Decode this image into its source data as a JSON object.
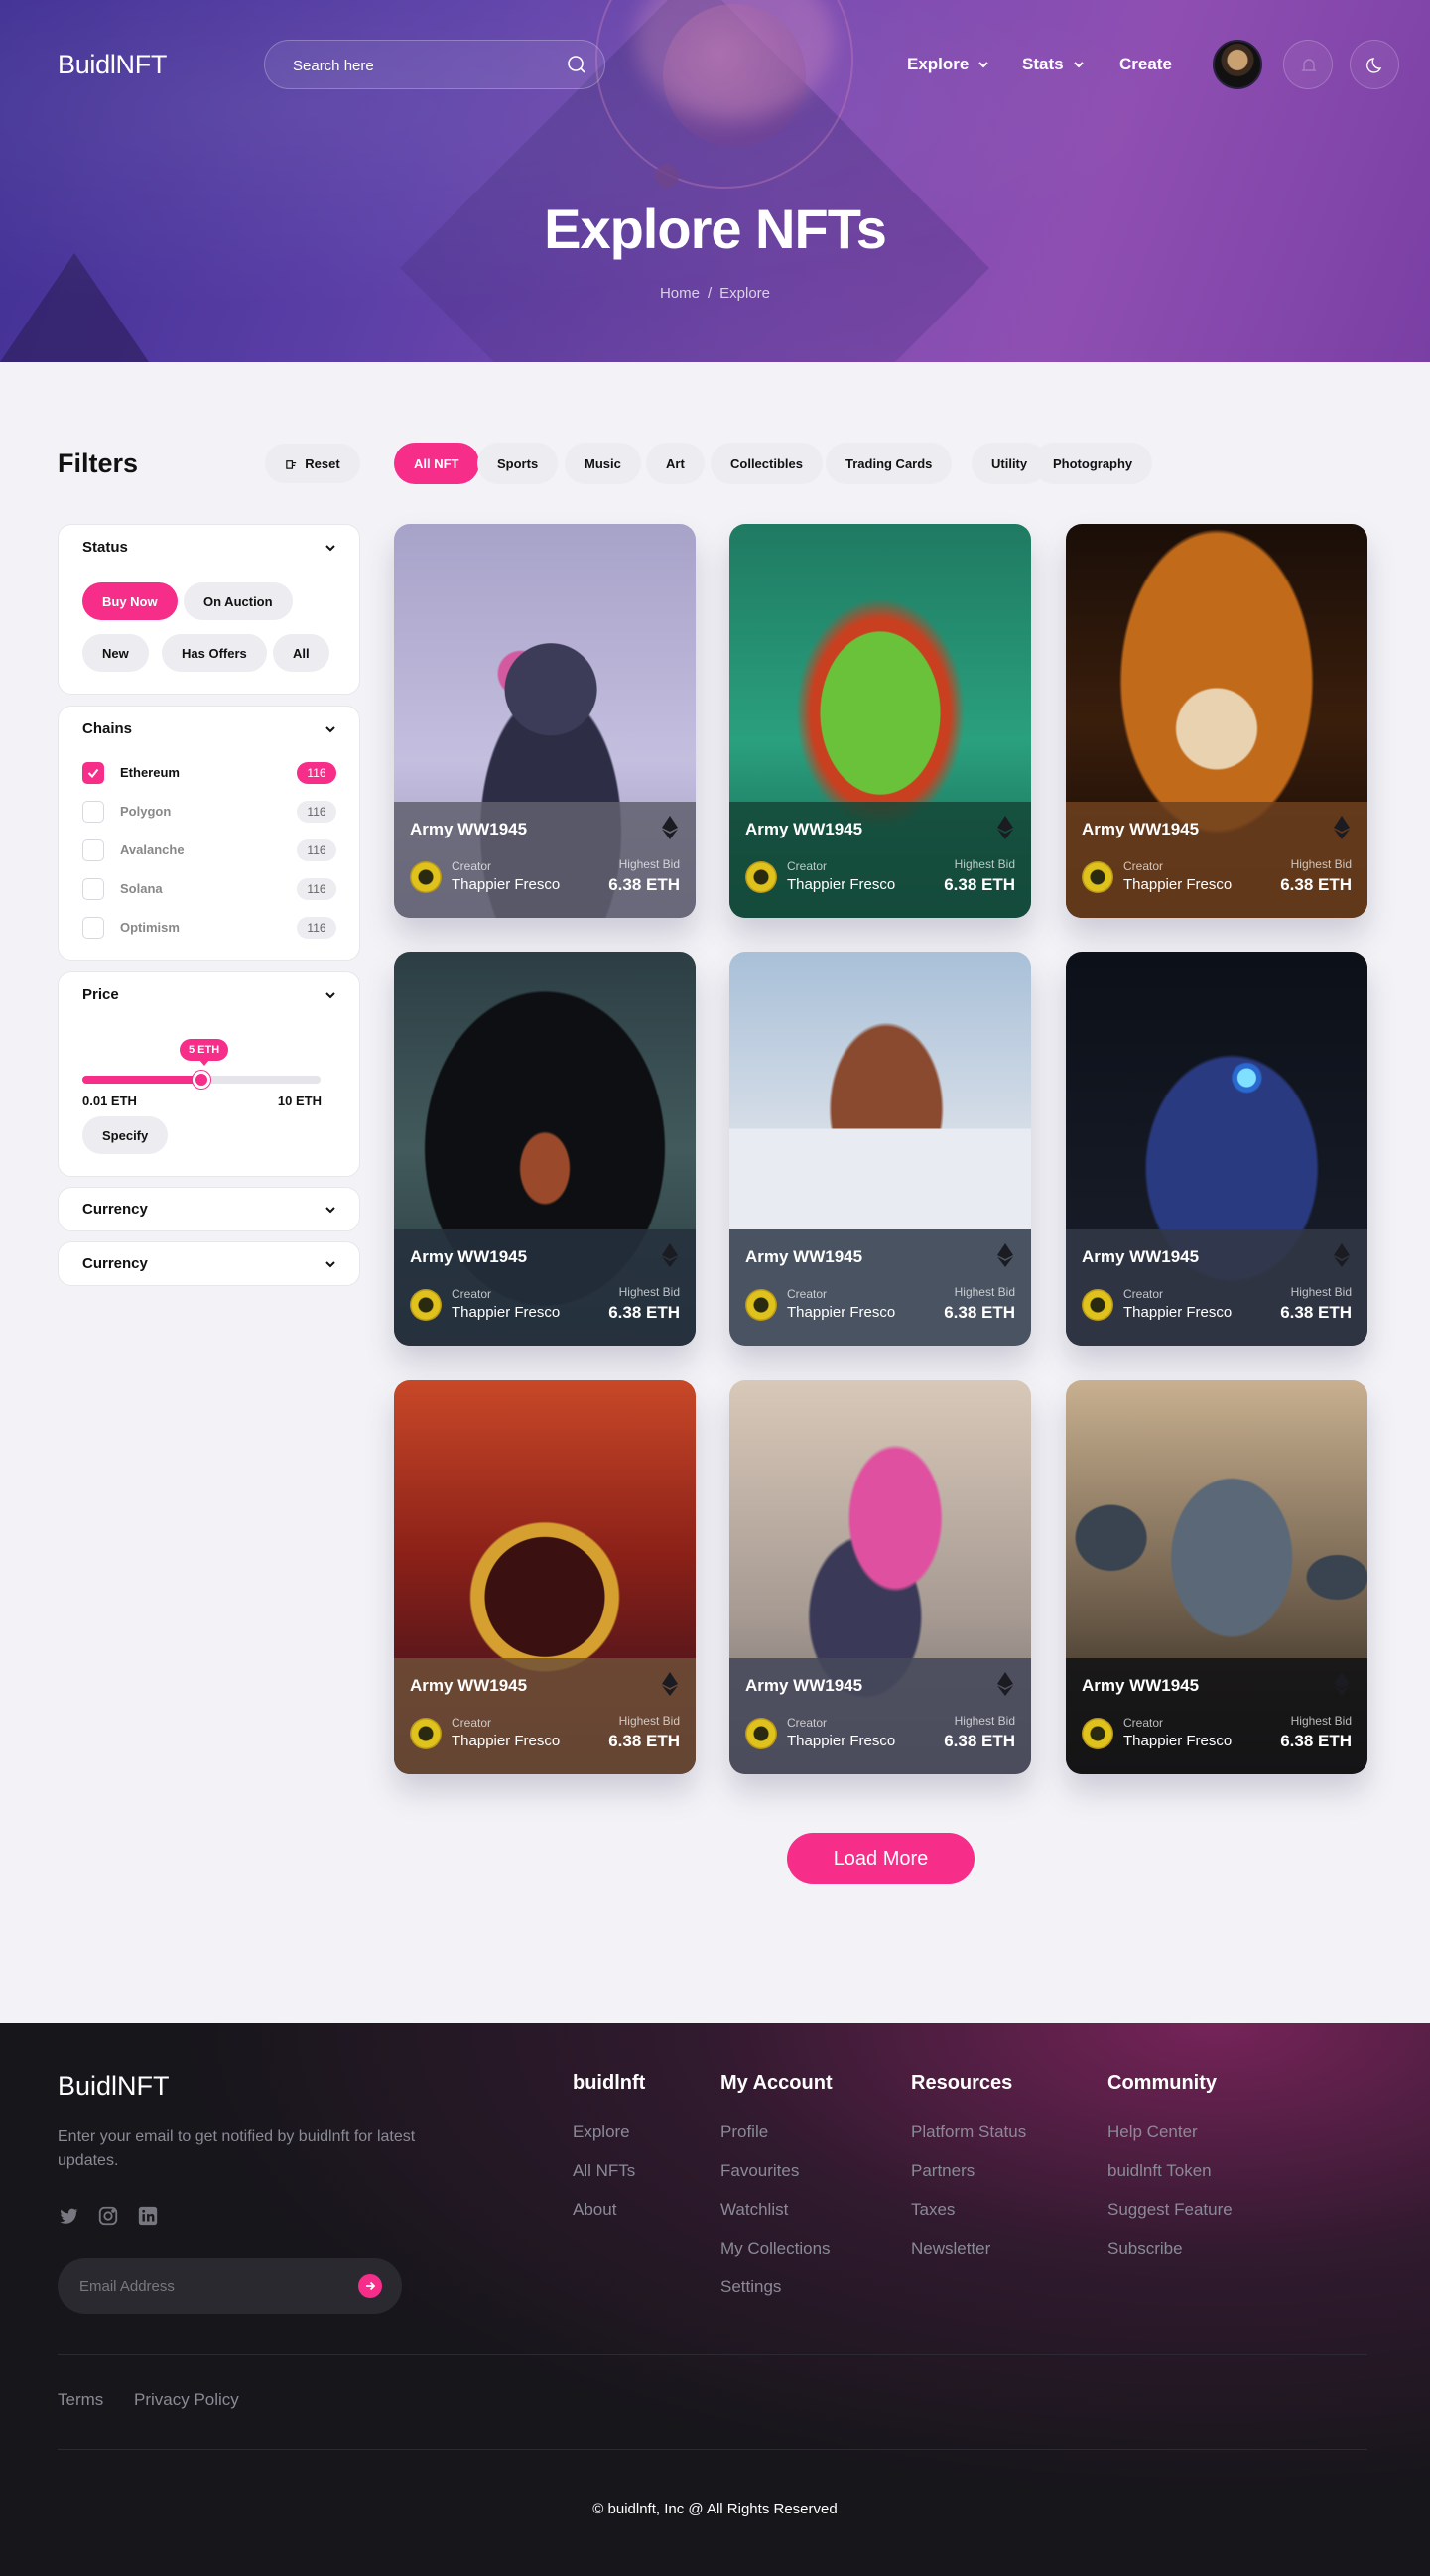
{
  "header": {
    "logo": "BuidlNFT",
    "search_placeholder": "Search here",
    "nav": [
      {
        "label": "Explore",
        "has_dropdown": true
      },
      {
        "label": "Stats",
        "has_dropdown": true
      },
      {
        "label": "Create",
        "has_dropdown": false
      }
    ]
  },
  "hero": {
    "title": "Explore NFTs",
    "breadcrumb": [
      "Home",
      "Explore"
    ],
    "breadcrumb_separator": "/"
  },
  "filters": {
    "title": "Filters",
    "reset_label": "Reset",
    "status": {
      "heading": "Status",
      "options": [
        "Buy Now",
        "On Auction",
        "New",
        "Has Offers",
        "All"
      ],
      "active": "Buy Now"
    },
    "chains": {
      "heading": "Chains",
      "items": [
        {
          "name": "Ethereum",
          "count": "116",
          "checked": true
        },
        {
          "name": "Polygon",
          "count": "116",
          "checked": false
        },
        {
          "name": "Avalanche",
          "count": "116",
          "checked": false
        },
        {
          "name": "Solana",
          "count": "116",
          "checked": false
        },
        {
          "name": "Optimism",
          "count": "116",
          "checked": false
        }
      ]
    },
    "price": {
      "heading": "Price",
      "current_label": "5 ETH",
      "current_value": 5,
      "min": 0.01,
      "max": 10,
      "min_label": "0.01 ETH",
      "max_label": "10 ETH",
      "specify_label": "Specify"
    },
    "currency_sections": [
      "Currency",
      "Currency"
    ]
  },
  "categories": {
    "items": [
      "All NFT",
      "Sports",
      "Music",
      "Art",
      "Collectibles",
      "Trading Cards",
      "Utility",
      "Photography"
    ],
    "active": "All NFT"
  },
  "cards": [
    {
      "name": "Army WW1945",
      "creator_label": "Creator",
      "creator": "Thappier Fresco",
      "bid_label": "Highest Bid",
      "bid": "6.38 ETH",
      "art": "floral-cyborg-head"
    },
    {
      "name": "Army WW1945",
      "creator_label": "Creator",
      "creator": "Thappier Fresco",
      "bid_label": "Highest Bid",
      "bid": "6.38 ETH",
      "art": "green-coral-sculpture"
    },
    {
      "name": "Army WW1945",
      "creator_label": "Creator",
      "creator": "Thappier Fresco",
      "bid_label": "Highest Bid",
      "bid": "6.38 ETH",
      "art": "golden-skull-horns"
    },
    {
      "name": "Army WW1945",
      "creator_label": "Creator",
      "creator": "Thappier Fresco",
      "bid_label": "Highest Bid",
      "bid": "6.38 ETH",
      "art": "winged-warrior"
    },
    {
      "name": "Army WW1945",
      "creator_label": "Creator",
      "creator": "Thappier Fresco",
      "bid_label": "Highest Bid",
      "bid": "6.38 ETH",
      "art": "desert-butte"
    },
    {
      "name": "Army WW1945",
      "creator_label": "Creator",
      "creator": "Thappier Fresco",
      "bid_label": "Highest Bid",
      "bid": "6.38 ETH",
      "art": "cyber-eagle"
    },
    {
      "name": "Army WW1945",
      "creator_label": "Creator",
      "creator": "Thappier Fresco",
      "bid_label": "Highest Bid",
      "bid": "6.38 ETH",
      "art": "astronaut-dog"
    },
    {
      "name": "Army WW1945",
      "creator_label": "Creator",
      "creator": "Thappier Fresco",
      "bid_label": "Highest Bid",
      "bid": "6.38 ETH",
      "art": "pink-dancer"
    },
    {
      "name": "Army WW1945",
      "creator_label": "Creator",
      "creator": "Thappier Fresco",
      "bid_label": "Highest Bid",
      "bid": "6.38 ETH",
      "art": "alien-figures"
    }
  ],
  "load_more_label": "Load More",
  "footer": {
    "logo": "BuidlNFT",
    "description": "Enter your email to get notified by buidlnft for latest updates.",
    "email_placeholder": "Email Address",
    "social": [
      "twitter-icon",
      "instagram-icon",
      "linkedin-icon"
    ],
    "columns": [
      {
        "title": "buidlnft",
        "links": [
          "Explore",
          "All NFTs",
          "About"
        ]
      },
      {
        "title": "My Account",
        "links": [
          "Profile",
          "Favourites",
          "Watchlist",
          "My Collections",
          "Settings"
        ]
      },
      {
        "title": "Resources",
        "links": [
          "Platform Status",
          "Partners",
          "Taxes",
          "Newsletter"
        ]
      },
      {
        "title": "Community",
        "links": [
          "Help Center",
          "buidlnft Token",
          "Suggest Feature",
          "Subscribe"
        ]
      }
    ],
    "legal": [
      "Terms",
      "Privacy Policy"
    ],
    "copyright": "© buidlnft, Inc @ All Rights Reserved"
  },
  "colors": {
    "accent": "#f72d8a",
    "footer_bg": "#17161b",
    "page_bg": "#f3f3f7"
  }
}
